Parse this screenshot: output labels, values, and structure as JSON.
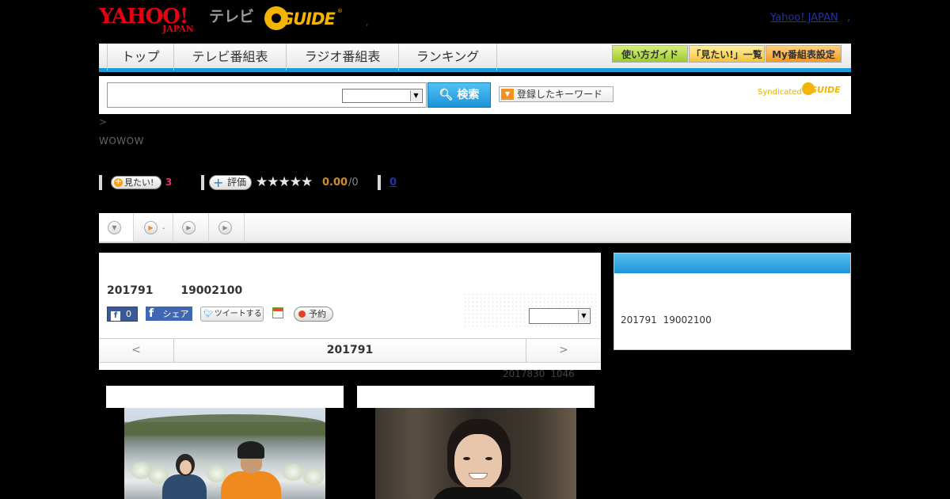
{
  "header": {
    "yahoo_logo": "YAHOO!",
    "yahoo_logo_sub": "JAPAN",
    "tv_label": "テレビ",
    "gguide_logo": "GUIDE",
    "gguide_reg": "®",
    "separator": ",",
    "yahoo_japan_link": "Yahoo! JAPAN",
    "yahoo_japan_link_sep": ","
  },
  "nav": {
    "items": [
      "トップ",
      "テレビ番組表",
      "ラジオ番組表",
      "ランキング"
    ],
    "guide_button": "使い方ガイド",
    "mitai_list_button": "「見たい!」一覧",
    "my_program_button": "My番組表設定"
  },
  "search": {
    "input_value": "",
    "select_value": "",
    "search_button": "検索",
    "keyword_button": "登録したキーワード",
    "syndicated_label": "Syndicated",
    "syndicated_logo": "GUIDE"
  },
  "breadcrumb": ">",
  "channel": "WOWOW",
  "rating": {
    "mitai_label": "見たい!",
    "mitai_count": "3",
    "eval_label": "評価",
    "stars": "★★★★★",
    "score": "0.00",
    "score_den": "/0",
    "review_count": "0"
  },
  "tabs": [
    {
      "label": ""
    },
    {
      "label": "."
    },
    {
      "label": ""
    },
    {
      "label": ""
    }
  ],
  "program": {
    "date_line": "201791 19002100",
    "fb_like_label": "f",
    "fb_like_count": "0",
    "fb_share_label": "シェア",
    "tweet_label": "ツイートする",
    "yoyaku_label": "予約",
    "select_value": "",
    "pager_prev": "<",
    "pager_title": "201791",
    "pager_next": ">",
    "updated": "2017830 1046"
  },
  "side": {
    "text": "201791 19002100"
  },
  "colors": {
    "accent_blue": "#1e9ad6",
    "yahoo_red": "#e60012",
    "gguide_yellow": "#f5b400",
    "mitai_pink": "#e8306a",
    "score_orange": "#d38c2a"
  }
}
